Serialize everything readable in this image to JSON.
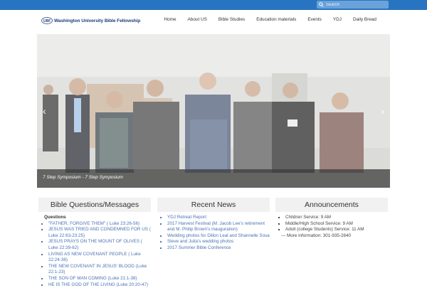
{
  "topbar": {
    "search_placeholder": "Search"
  },
  "header": {
    "logo_text": "Washington University Bible Fellowship"
  },
  "nav": [
    "Home",
    "About US",
    "Bible Studies",
    "Education materials",
    "Events",
    "YDJ",
    "Daily Bread"
  ],
  "hero": {
    "caption": "7 Step Symposium",
    "caption_link": "7 Step Symposium",
    "caption_sep": " - "
  },
  "columns": {
    "bible": {
      "title": "Bible Questions/Messages",
      "subhead": "Questions",
      "items": [
        "\"FATHER, FORGIVE THEM\" ( Luke 23:26-56)",
        "JESUS WAS TRIED AND CONDEMNED FOR US ( Luke 22:63-23:25)",
        "JESUS PRAYS ON THE MOUNT OF OLIVES ( Luke 22:39-62)",
        "LIVING AS NEW COVENANT PEOPLE ( Luke 22:24-38)",
        "THE NEW COVENANT IN JESUS' BLOOD (Luke 22:1-23)",
        "THE SON OF MAN COMING (Luke 21:1-38)",
        "HE IS THE GOD OF THE LIVING (Luke 20:20-47)"
      ]
    },
    "news": {
      "title": "Recent News",
      "items": [
        "YDJ Retreat Report",
        "2017 Harvest Festival (M. Jacob Lee's retirement and M. Philip Brown's inauguration)",
        "Wedding photos for Dillon Leal and Shannelle Sosa",
        "Steve and Julia's wedding photos",
        "2017 Summer Bible Conference"
      ]
    },
    "announcements": {
      "title": "Announcements",
      "items": [
        "Children Service: 9 AM",
        "Middle/High School Service: 9 AM",
        "Adult (college Students) Service: 11 AM"
      ],
      "more": "--- More information: 301-935-2640"
    }
  },
  "colors": {
    "topbar": "#2874c0",
    "link": "#4a72b4",
    "logo": "#1e3f7a"
  }
}
